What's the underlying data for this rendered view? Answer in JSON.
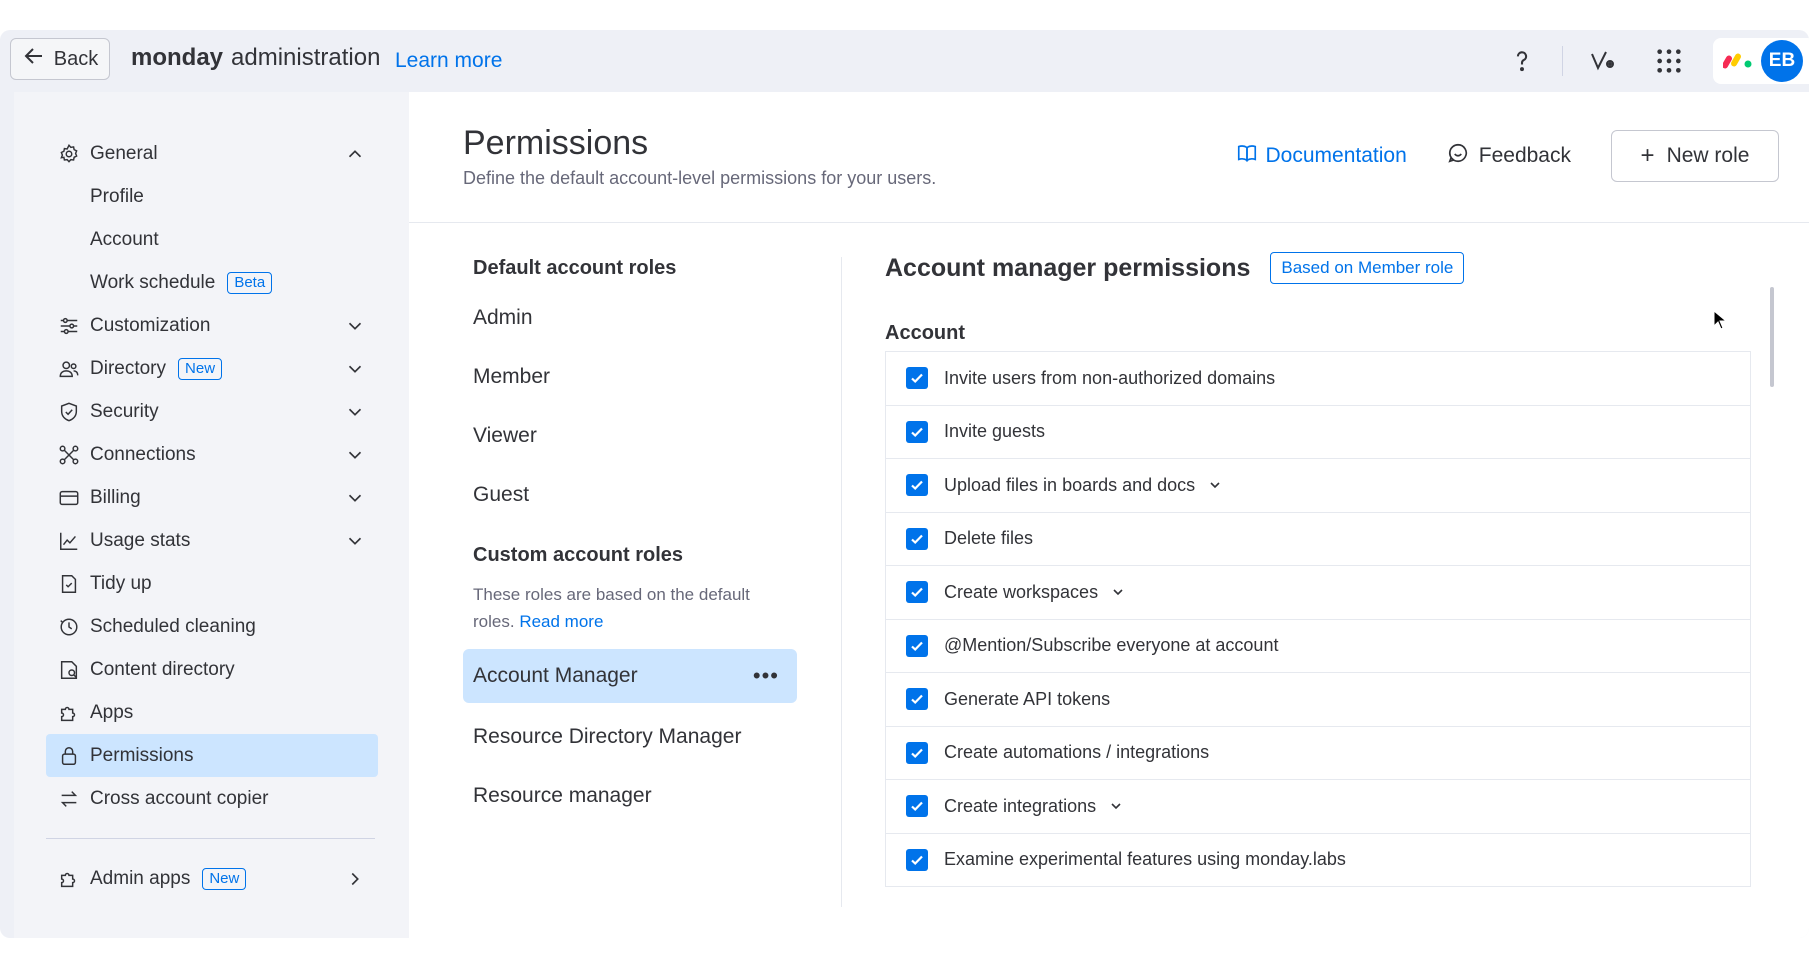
{
  "topbar": {
    "back_label": "Back",
    "brand_bold": "monday",
    "brand_rest": "administration",
    "learn_more": "Learn more",
    "avatar_initials": "EB"
  },
  "sidebar": {
    "items": [
      {
        "label": "General",
        "icon": "gear-icon",
        "chevron": "up"
      },
      {
        "label": "Profile"
      },
      {
        "label": "Account"
      },
      {
        "label": "Work schedule",
        "badge": "Beta"
      },
      {
        "label": "Customization",
        "icon": "sliders-icon",
        "chevron": "down"
      },
      {
        "label": "Directory",
        "icon": "people-icon",
        "chevron": "down",
        "badge": "New"
      },
      {
        "label": "Security",
        "icon": "shield-icon",
        "chevron": "down"
      },
      {
        "label": "Connections",
        "icon": "connections-icon",
        "chevron": "down"
      },
      {
        "label": "Billing",
        "icon": "card-icon",
        "chevron": "down"
      },
      {
        "label": "Usage stats",
        "icon": "chart-icon",
        "chevron": "down"
      },
      {
        "label": "Tidy up",
        "icon": "broom-icon"
      },
      {
        "label": "Scheduled cleaning",
        "icon": "clock-icon"
      },
      {
        "label": "Content directory",
        "icon": "folder-icon"
      },
      {
        "label": "Apps",
        "icon": "puzzle-icon"
      },
      {
        "label": "Permissions",
        "icon": "lock-icon",
        "active": true
      },
      {
        "label": "Cross account copier",
        "icon": "swap-icon"
      }
    ],
    "admin_apps": {
      "label": "Admin apps",
      "badge": "New"
    }
  },
  "header": {
    "title": "Permissions",
    "subtitle": "Define the default account-level permissions for your users.",
    "documentation": "Documentation",
    "feedback": "Feedback",
    "new_role": "New role"
  },
  "roles": {
    "default_heading": "Default account roles",
    "default": [
      "Admin",
      "Member",
      "Viewer",
      "Guest"
    ],
    "custom_heading": "Custom account roles",
    "custom_desc": "These roles are based on the default roles.",
    "read_more": "Read more",
    "custom": [
      "Account Manager",
      "Resource Directory Manager",
      "Resource manager"
    ],
    "selected": "Account Manager"
  },
  "permissions": {
    "title": "Account manager permissions",
    "based_on": "Based on Member role",
    "section": "Account",
    "items": [
      {
        "label": "Invite users from non-authorized domains",
        "checked": true,
        "dropdown": false
      },
      {
        "label": "Invite guests",
        "checked": true,
        "dropdown": false
      },
      {
        "label": "Upload files in boards and docs",
        "checked": true,
        "dropdown": true
      },
      {
        "label": "Delete files",
        "checked": true,
        "dropdown": false
      },
      {
        "label": "Create workspaces",
        "checked": true,
        "dropdown": true
      },
      {
        "label": "@Mention/Subscribe everyone at account",
        "checked": true,
        "dropdown": false
      },
      {
        "label": "Generate API tokens",
        "checked": true,
        "dropdown": false
      },
      {
        "label": "Create automations / integrations",
        "checked": true,
        "dropdown": false
      },
      {
        "label": "Create integrations",
        "checked": true,
        "dropdown": true
      },
      {
        "label": "Examine experimental features using monday.labs",
        "checked": true,
        "dropdown": false
      }
    ]
  },
  "colors": {
    "accent": "#0073ea",
    "selected_bg": "#cce5ff",
    "text": "#323338",
    "muted": "#676879"
  }
}
